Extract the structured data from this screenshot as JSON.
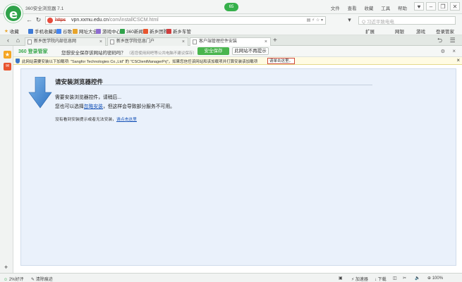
{
  "window": {
    "title": "360安全浏览器 7.1",
    "badge": "65",
    "menu": [
      "文件",
      "查看",
      "收藏",
      "工具",
      "帮助"
    ],
    "controls": [
      "♥",
      "–",
      "❐",
      "✕"
    ]
  },
  "nav": {
    "address_scheme": "https",
    "address_host": "vpn.xxmu.edu.cn",
    "address_path": "/com/installCSCM.html",
    "address_tools": "▤ ⚡ ☆ ▾",
    "search_placeholder": "Q 习近平致电电"
  },
  "bookmarks": {
    "favorites_label": "收藏",
    "items": [
      {
        "label": "手机收藏夹",
        "color": "#3d7ad6"
      },
      {
        "label": "谷歌",
        "color": "#4285f4"
      },
      {
        "label": "网址大全",
        "color": "#e7a42b"
      },
      {
        "label": "游戏中心",
        "color": "#8e6bd1"
      },
      {
        "label": "360新闻",
        "color": "#2fa24a"
      },
      {
        "label": "新乡团购",
        "color": "#e8552e"
      },
      {
        "label": "新乡车管",
        "color": "#d03d3d"
      }
    ],
    "right": [
      "扩展",
      "网银",
      "游戏",
      "登录管家"
    ]
  },
  "tabs": [
    {
      "label": "新乡医学院内部信息网"
    },
    {
      "label": "新乡医学院信息门户"
    },
    {
      "label": "客户端管理控件安装"
    }
  ],
  "notebar": {
    "brand": "360 登录管家",
    "question": "您想安全保存该网站的密码吗？",
    "hint": "（若您使用网吧等公共电脑不建议保存）",
    "save": "安全保存",
    "never": "此网站不再提示"
  },
  "infobar": {
    "text": "此网站需要安装以下加载项: \"Sangfor Technologies Co.,Ltd\" 的 \"CSClientManagerPrj\"，如果您信任该网站和该加载项并打算安装该加载项",
    "link": "请单击这里。"
  },
  "content": {
    "title": "请安装浏览器控件",
    "line1": "需要安装浏览器控件，请稍后...",
    "line2_pre": "您也可以选择",
    "line2_link": "忽略安装",
    "line2_post": "，但这样会导致部分服务不可用。",
    "line3_pre": "没有看到安装提示或者无法安装，",
    "line3_link": "请点击这里"
  },
  "status": {
    "left": "2%好评",
    "clean": "清除痕迹",
    "accel": "加速器",
    "download": "下载",
    "zoom": "100%"
  }
}
